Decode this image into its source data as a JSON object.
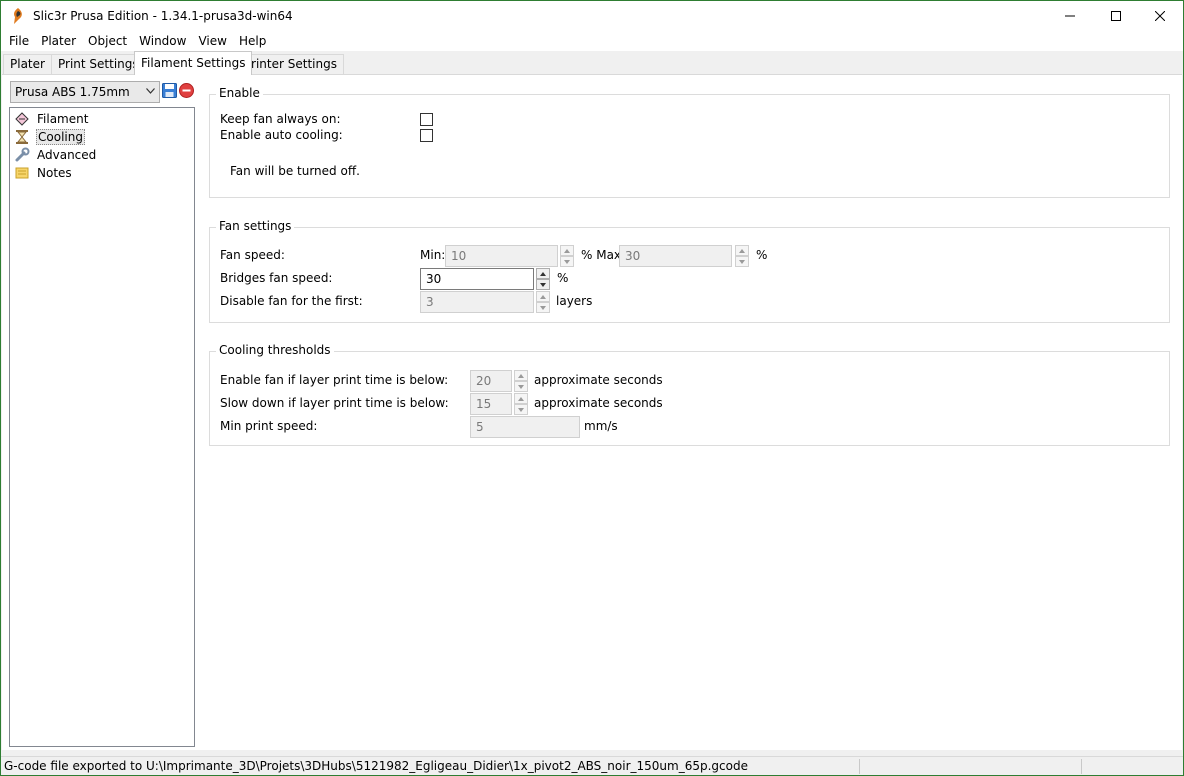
{
  "window": {
    "title": "Slic3r Prusa Edition - 1.34.1-prusa3d-win64"
  },
  "menu": [
    "File",
    "Plater",
    "Object",
    "Window",
    "View",
    "Help"
  ],
  "tabs": [
    "Plater",
    "Print Settings",
    "Filament Settings",
    "Printer Settings"
  ],
  "active_tab": "Filament Settings",
  "preset": {
    "selected": "Prusa ABS 1.75mm"
  },
  "tree": {
    "items": [
      {
        "label": "Filament",
        "icon": "filament-icon"
      },
      {
        "label": "Cooling",
        "icon": "hourglass-icon"
      },
      {
        "label": "Advanced",
        "icon": "wrench-icon"
      },
      {
        "label": "Notes",
        "icon": "note-icon"
      }
    ],
    "selected": "Cooling"
  },
  "enable": {
    "title": "Enable",
    "keep_fan_label": "Keep fan always on:",
    "keep_fan_checked": false,
    "auto_cooling_label": "Enable auto cooling:",
    "auto_cooling_checked": false,
    "description": "Fan will be turned off."
  },
  "fan_settings": {
    "title": "Fan settings",
    "fan_speed_label": "Fan speed:",
    "min_label": "Min:",
    "min_value": "10",
    "max_label": "% Max:",
    "max_value": "30",
    "max_unit": "%",
    "bridges_label": "Bridges fan speed:",
    "bridges_value": "30",
    "bridges_unit": "%",
    "disable_first_label": "Disable fan for the first:",
    "disable_first_value": "3",
    "disable_first_unit": "layers"
  },
  "cooling_thresholds": {
    "title": "Cooling thresholds",
    "enable_fan_label": "Enable fan if layer print time is below:",
    "enable_fan_value": "20",
    "enable_fan_unit": "approximate seconds",
    "slowdown_label": "Slow down if layer print time is below:",
    "slowdown_value": "15",
    "slowdown_unit": "approximate seconds",
    "min_speed_label": "Min print speed:",
    "min_speed_value": "5",
    "min_speed_unit": "mm/s"
  },
  "status": {
    "text": "G-code file exported to U:\\Imprimante_3D\\Projets\\3DHubs\\5121982_Egligeau_Didier\\1x_pivot2_ABS_noir_150um_65p.gcode"
  },
  "colors": {
    "window_border": "#2e7d32",
    "panel_bg": "#f0f0f0",
    "disabled_text": "#7a7a7a"
  }
}
